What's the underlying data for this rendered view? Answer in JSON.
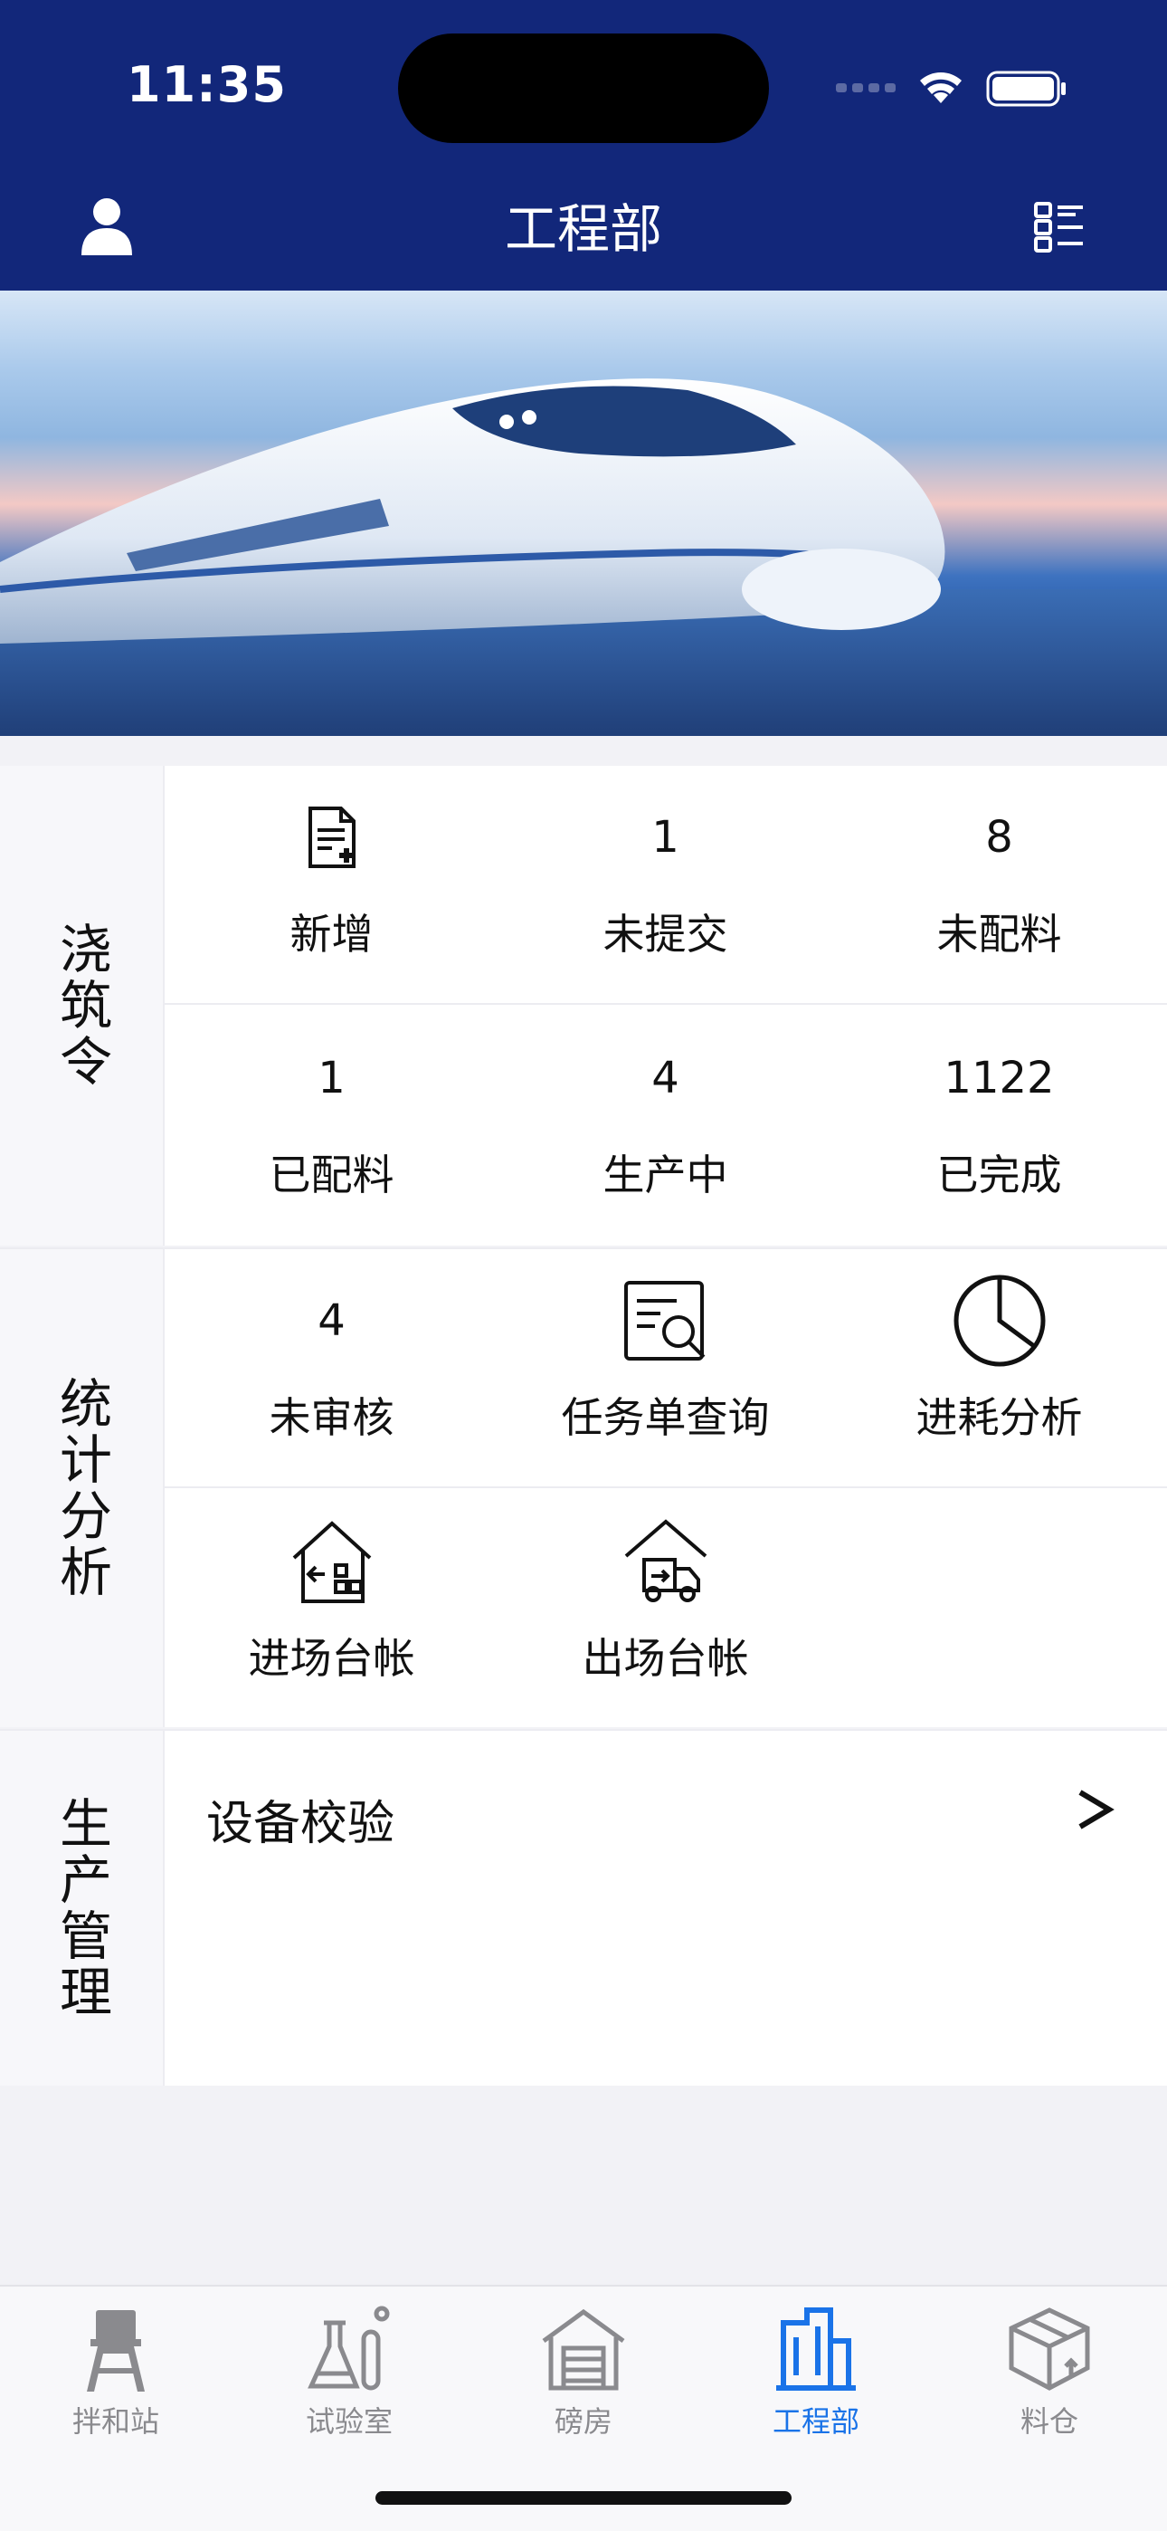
{
  "status_bar": {
    "time": "11:35"
  },
  "nav": {
    "title": "工程部",
    "user_icon": "user-icon",
    "menu_icon": "list-menu-icon"
  },
  "banner": {
    "alt": "high-speed train"
  },
  "pour_orders": {
    "label": "浇筑令",
    "rows": [
      [
        {
          "type": "icon",
          "icon": "add-document-icon",
          "label": "新增"
        },
        {
          "type": "count",
          "value": "1",
          "label": "未提交"
        },
        {
          "type": "count",
          "value": "8",
          "label": "未配料"
        }
      ],
      [
        {
          "type": "count",
          "value": "1",
          "label": "已配料"
        },
        {
          "type": "count",
          "value": "4",
          "label": "生产中"
        },
        {
          "type": "count",
          "value": "1122",
          "label": "已完成"
        }
      ]
    ]
  },
  "stats": {
    "label": "统计分析",
    "rows": [
      [
        {
          "type": "count",
          "value": "4",
          "label": "未审核"
        },
        {
          "type": "icon",
          "icon": "document-search-icon",
          "label": "任务单查询"
        },
        {
          "type": "icon",
          "icon": "pie-chart-icon",
          "label": "进耗分析"
        }
      ],
      [
        {
          "type": "icon",
          "icon": "warehouse-in-icon",
          "label": "进场台帐"
        },
        {
          "type": "icon",
          "icon": "warehouse-out-icon",
          "label": "出场台帐"
        }
      ]
    ]
  },
  "production": {
    "label": "生产管理",
    "items": [
      {
        "label": "设备校验",
        "chevron": ">"
      }
    ]
  },
  "tabbar": {
    "active_color": "#1a73e8",
    "inactive_color": "#8a8a8e",
    "tabs": [
      {
        "label": "拌和站",
        "icon": "water-tower-icon",
        "active": false
      },
      {
        "label": "试验室",
        "icon": "lab-flask-icon",
        "active": false
      },
      {
        "label": "磅房",
        "icon": "garage-icon",
        "active": false
      },
      {
        "label": "工程部",
        "icon": "building-icon",
        "active": true
      },
      {
        "label": "料仓",
        "icon": "box-icon",
        "active": false
      }
    ]
  }
}
